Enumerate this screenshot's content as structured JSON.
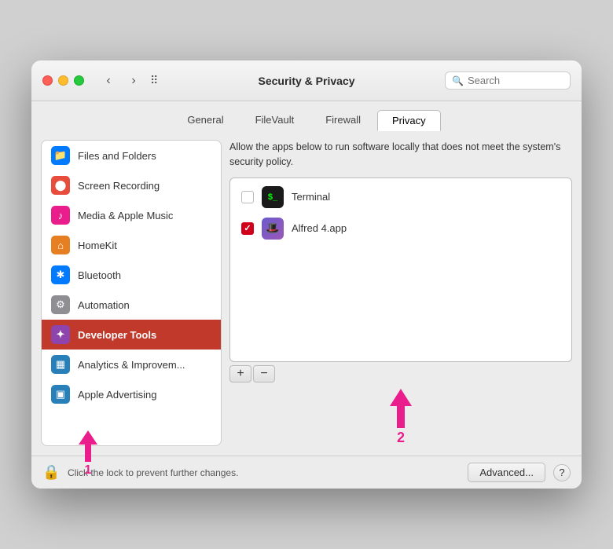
{
  "window": {
    "title": "Security & Privacy"
  },
  "search": {
    "placeholder": "Search"
  },
  "tabs": [
    {
      "label": "General",
      "active": false
    },
    {
      "label": "FileVault",
      "active": false
    },
    {
      "label": "Firewall",
      "active": false
    },
    {
      "label": "Privacy",
      "active": true
    }
  ],
  "sidebar": {
    "items": [
      {
        "id": "files-folders",
        "label": "Files and Folders",
        "icon": "folder",
        "iconClass": "icon-blue",
        "active": false
      },
      {
        "id": "screen-recording",
        "label": "Screen Recording",
        "icon": "●",
        "iconClass": "icon-red",
        "active": false
      },
      {
        "id": "media-apple-music",
        "label": "Media & Apple Music",
        "icon": "♪",
        "iconClass": "icon-pink",
        "active": false
      },
      {
        "id": "homekit",
        "label": "HomeKit",
        "icon": "⌂",
        "iconClass": "icon-orange",
        "active": false
      },
      {
        "id": "bluetooth",
        "label": "Bluetooth",
        "icon": "✱",
        "iconClass": "icon-bluetooth",
        "active": false
      },
      {
        "id": "automation",
        "label": "Automation",
        "icon": "⚙",
        "iconClass": "icon-gray",
        "active": false
      },
      {
        "id": "developer-tools",
        "label": "Developer Tools",
        "icon": "✦",
        "iconClass": "icon-dev",
        "active": true
      },
      {
        "id": "analytics",
        "label": "Analytics & Improvem...",
        "icon": "▦",
        "iconClass": "icon-analytics",
        "active": false
      },
      {
        "id": "apple-advertising",
        "label": "Apple Advertising",
        "icon": "▣",
        "iconClass": "icon-advert",
        "active": false
      }
    ]
  },
  "panel": {
    "description": "Allow the apps below to run software locally that does not meet the system's security policy.",
    "apps": [
      {
        "name": "Terminal",
        "checked": false,
        "iconType": "terminal"
      },
      {
        "name": "Alfred 4.app",
        "checked": true,
        "iconType": "alfred"
      }
    ],
    "add_label": "+",
    "remove_label": "−",
    "annotation_number": "2"
  },
  "bottom": {
    "lock_text": "Click the lock to prevent further changes.",
    "advanced_label": "Advanced...",
    "help_label": "?",
    "annotation_number": "1"
  }
}
